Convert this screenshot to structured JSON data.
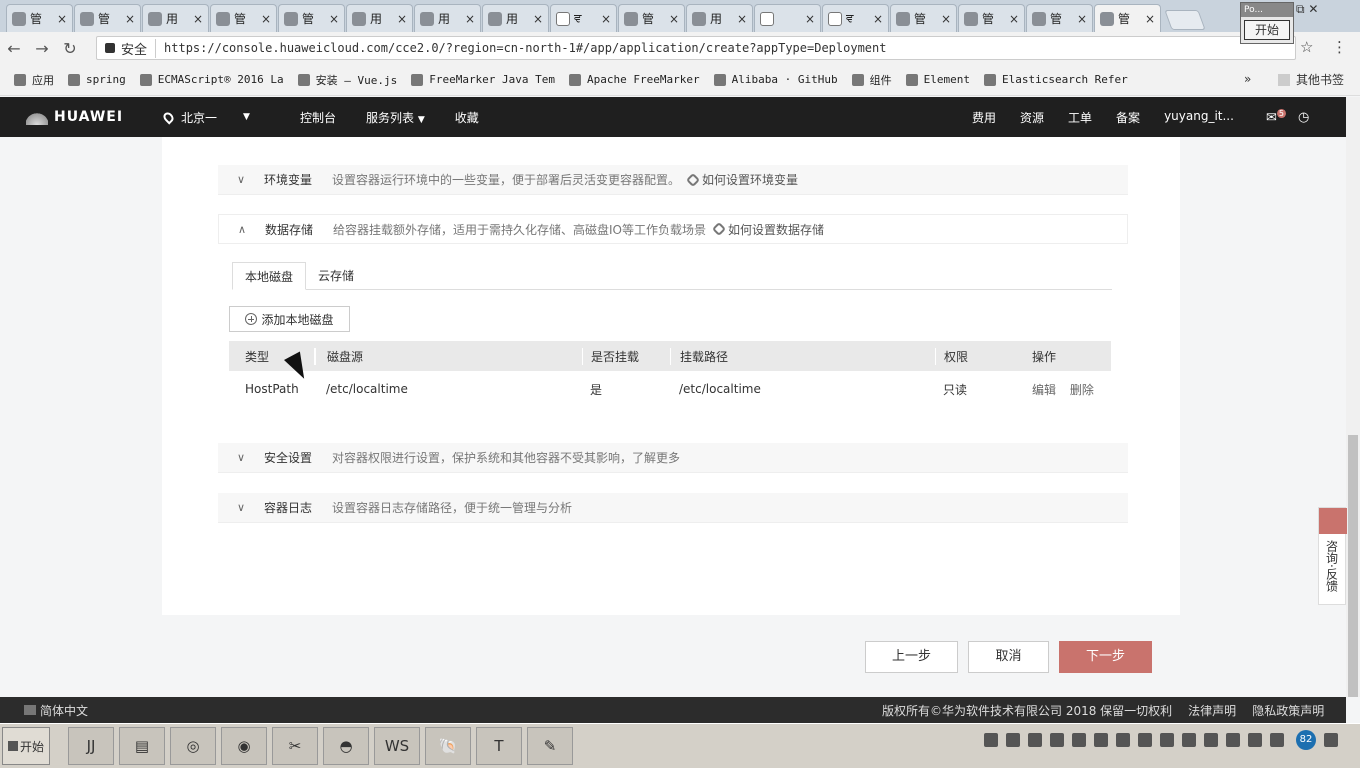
{
  "browser": {
    "tabs": [
      {
        "label": "管",
        "icon": "app"
      },
      {
        "label": "管",
        "icon": "app"
      },
      {
        "label": "用",
        "icon": "app"
      },
      {
        "label": "管",
        "icon": "app"
      },
      {
        "label": "管",
        "icon": "app"
      },
      {
        "label": "用",
        "icon": "app"
      },
      {
        "label": "用",
        "icon": "app"
      },
      {
        "label": "用",
        "icon": "app"
      },
      {
        "label": "ਵ",
        "icon": "doc"
      },
      {
        "label": "管",
        "icon": "app"
      },
      {
        "label": "用",
        "icon": "app"
      },
      {
        "label": "",
        "icon": "doc"
      },
      {
        "label": "ਵ",
        "icon": "doc"
      },
      {
        "label": "管",
        "icon": "app"
      },
      {
        "label": "管",
        "icon": "app"
      },
      {
        "label": "管",
        "icon": "app"
      },
      {
        "label": "管",
        "icon": "app",
        "active": true
      }
    ],
    "tab_close": "×",
    "popup_title": "Po...",
    "popup_button": "开始",
    "secure_label": "安全",
    "url": "https://console.huaweicloud.com/cce2.0/?region=cn-north-1#/app/application/create?appType=Deployment",
    "bookmarks": [
      "应用",
      "spring",
      "ECMAScript® 2016 La",
      "安装 — Vue.js",
      "FreeMarker Java Tem",
      "Apache FreeMarker",
      "Alibaba · GitHub",
      "组件",
      "Element",
      "Elasticsearch Refer"
    ],
    "bookmarks_more": "»",
    "other_bookmarks": "其他书签"
  },
  "topnav": {
    "brand": "HUAWEI",
    "region": "北京一",
    "console": "控制台",
    "services": "服务列表",
    "favorites": "收藏",
    "right": [
      "费用",
      "资源",
      "工单",
      "备案",
      "yuyang_it..."
    ],
    "notification_count": "5"
  },
  "sections": {
    "env": {
      "title": "环境变量",
      "desc": "设置容器运行环境中的一些变量，便于部署后灵活变更容器配置。",
      "link": "如何设置环境变量"
    },
    "storage": {
      "title": "数据存储",
      "desc": "给容器挂载额外存储，适用于需持久化存储、高磁盘IO等工作负载场景",
      "link": "如何设置数据存储"
    },
    "security": {
      "title": "安全设置",
      "desc": "对容器权限进行设置，保护系统和其他容器不受其影响，了解更多"
    },
    "logs": {
      "title": "容器日志",
      "desc": "设置容器日志存储路径，便于统一管理与分析"
    }
  },
  "storage_tabs": [
    "本地磁盘",
    "云存储"
  ],
  "add_disk_label": "添加本地磁盘",
  "table": {
    "headers": [
      "类型",
      "磁盘源",
      "是否挂载",
      "挂载路径",
      "权限",
      "操作"
    ],
    "rows": [
      {
        "type": "HostPath",
        "source": "/etc/localtime",
        "mounted": "是",
        "path": "/etc/localtime",
        "perm": "只读",
        "edit": "编辑",
        "delete": "删除"
      }
    ]
  },
  "actions": {
    "prev": "上一步",
    "cancel": "取消",
    "next": "下一步"
  },
  "footer": {
    "lang": "简体中文",
    "copyright": "版权所有©华为软件技术有限公司 2018 保留一切权利",
    "legal": "法律声明",
    "privacy": "隐私政策声明"
  },
  "feedback": "咨询·反馈",
  "taskbar": {
    "start": "开始",
    "apps": [
      "JJ",
      "▤",
      "◎",
      "◉",
      "✂",
      "◓",
      "WS",
      "🐚",
      "T",
      "✎"
    ],
    "tray_badge": "82"
  },
  "colors": {
    "accent": "#c9736d",
    "nav_bg": "#1f1f1f"
  }
}
